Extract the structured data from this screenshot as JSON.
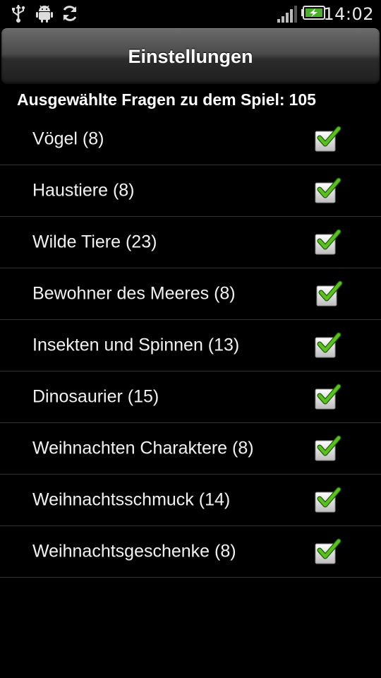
{
  "status_bar": {
    "icons": [
      "usb-icon",
      "android-debug-icon",
      "sync-icon",
      "signal-icon",
      "battery-charging-icon"
    ],
    "time": "14:02"
  },
  "header": {
    "title": "Einstellungen"
  },
  "summary": {
    "label": "Ausgewählte Fragen zu dem Spiel:",
    "count": "105"
  },
  "categories": [
    {
      "label": "Vögel (8)",
      "checked": true
    },
    {
      "label": "Haustiere (8)",
      "checked": true
    },
    {
      "label": "Wilde Tiere (23)",
      "checked": true
    },
    {
      "label": "Bewohner des Meeres (8)",
      "checked": true
    },
    {
      "label": "Insekten und Spinnen (13)",
      "checked": true
    },
    {
      "label": "Dinosaurier (15)",
      "checked": true
    },
    {
      "label": "Weihnachten Charaktere (8)",
      "checked": true
    },
    {
      "label": "Weihnachtsschmuck (14)",
      "checked": true
    },
    {
      "label": "Weihnachtsgeschenke (8)",
      "checked": true
    }
  ],
  "colors": {
    "background": "#000000",
    "check_green": "#5bbf1e",
    "divider": "#333333"
  }
}
